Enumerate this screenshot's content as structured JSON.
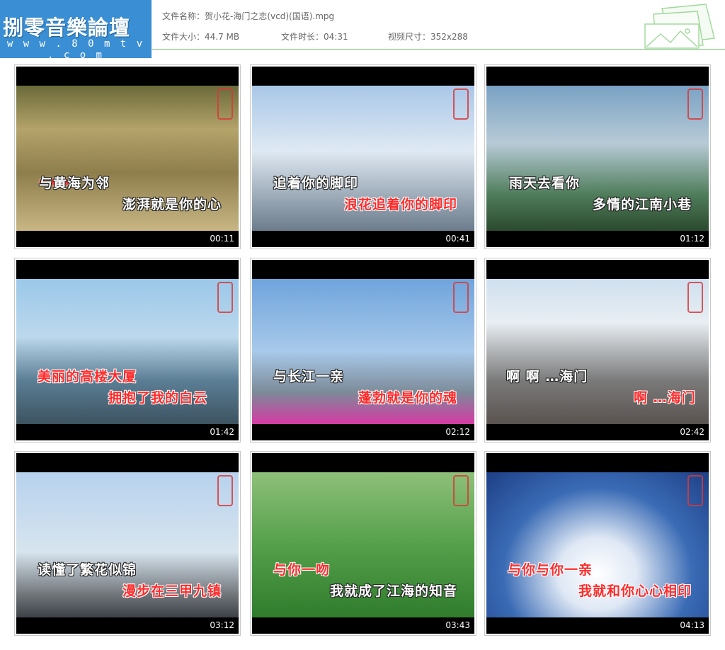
{
  "header": {
    "logo_text": "捌零音樂論壇",
    "logo_url": "w w w . 8 0 m t v . c o m",
    "file_name_label": "文件名称：",
    "file_name": "贺小花-海门之恋(vcd)(国语).mpg",
    "file_size_label": "文件大小：",
    "file_size": "44.7 MB",
    "duration_label": "文件时长：",
    "duration": "04:31",
    "resolution_label": "视频尺寸：",
    "resolution": "352x288",
    "accent_color": "#7cc576",
    "logo_bg_color": "#3a8ed3"
  },
  "thumbnails": [
    {
      "time": "00:11",
      "dots": "● ● ●",
      "line1": "与黄海为邻",
      "line2": "澎湃就是你的心",
      "scene": "sea"
    },
    {
      "time": "00:41",
      "dots": "",
      "line1": "追着你的脚印",
      "line2": "浪花追着你的脚印",
      "scene": "port"
    },
    {
      "time": "01:12",
      "dots": "●",
      "line1": "雨天去看你",
      "line2": "多情的江南小巷",
      "scene": "train"
    },
    {
      "time": "01:42",
      "dots": "",
      "line1": "美丽的高楼大厦",
      "line2": "拥抱了我的白云",
      "scene": "crane"
    },
    {
      "time": "02:12",
      "dots": "",
      "line1": "与长江一亲",
      "line2": "蓬勃就是你的魂",
      "scene": "city"
    },
    {
      "time": "02:42",
      "dots": "",
      "line1": "啊 啊 …海门",
      "line2": "啊 …海门",
      "scene": "arch"
    },
    {
      "time": "03:12",
      "dots": "",
      "line1": "读懂了繁花似锦",
      "line2": "漫步在三甲九镇",
      "scene": "tower"
    },
    {
      "time": "03:43",
      "dots": "",
      "line1": "与你一吻",
      "line2": "我就成了江海的知音",
      "scene": "park"
    },
    {
      "time": "04:13",
      "dots": "",
      "line1": "与你与你一亲",
      "line2": "我就和你心心相印",
      "scene": "wave"
    }
  ]
}
